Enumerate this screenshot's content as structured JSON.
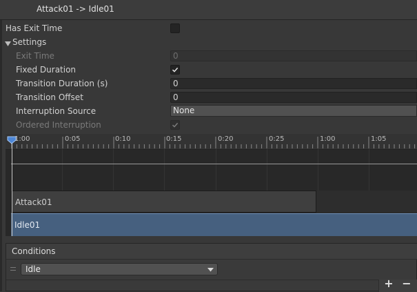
{
  "header": {
    "title": "Attack01 -> Idle01"
  },
  "settings": {
    "has_exit_time": {
      "label": "Has Exit Time",
      "checked": false
    },
    "section_label": "Settings",
    "exit_time": {
      "label": "Exit Time",
      "value": "0"
    },
    "fixed_duration": {
      "label": "Fixed Duration",
      "checked": true
    },
    "transition_duration": {
      "label": "Transition Duration (s)",
      "value": "0"
    },
    "transition_offset": {
      "label": "Transition Offset",
      "value": "0"
    },
    "interruption_source": {
      "label": "Interruption Source",
      "value": "None"
    },
    "ordered_interruption": {
      "label": "Ordered Interruption",
      "checked": true
    }
  },
  "timeline": {
    "ticks": [
      "1:00",
      "0:05",
      "0:10",
      "0:15",
      "0:20",
      "0:25",
      "1:00",
      "1:05"
    ],
    "clips": {
      "source": "Attack01",
      "destination": "Idle01"
    }
  },
  "conditions": {
    "title": "Conditions",
    "items": [
      {
        "parameter": "Idle"
      }
    ],
    "add_label": "+",
    "remove_label": "−"
  },
  "colors": {
    "background": "#383838",
    "selected_clip": "#46607f",
    "field": "#2a2a2a"
  }
}
